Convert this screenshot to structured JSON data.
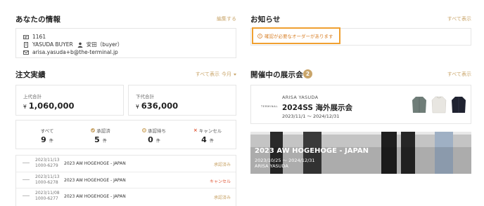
{
  "info": {
    "title": "あなたの情報",
    "edit_link": "編集する",
    "id": "1161",
    "company": "YASUDA BUYER",
    "user": "安田（buyer）",
    "email": "arisa.yasuda+b@the-terminal.jp"
  },
  "notices": {
    "title": "お知らせ",
    "see_all": "すべて表示",
    "alert": "確認が必要なオーダーがあります"
  },
  "orders": {
    "title": "注文実績",
    "see_all": "すべて表示",
    "period": "今月",
    "upper_label": "上代合計",
    "upper_value": "1,060,000",
    "lower_label": "下代合計",
    "lower_value": "636,000",
    "currency": "¥",
    "stats": [
      {
        "label": "すべて",
        "count": "9",
        "unit": "件"
      },
      {
        "label": "承認済",
        "count": "5",
        "unit": "件"
      },
      {
        "label": "承認待ち",
        "count": "0",
        "unit": "件"
      },
      {
        "label": "キャンセル",
        "count": "4",
        "unit": "件"
      }
    ],
    "rows": [
      {
        "date": "2023/11/13",
        "no": "1000-6279",
        "name": "2023 AW HOGEHOGE - JAPAN",
        "status": "承認済み",
        "status_color": "#c9a56a"
      },
      {
        "date": "2023/11/13",
        "no": "1000-6278",
        "name": "2023 AW HOGEHOGE - JAPAN",
        "status": "キャンセル",
        "status_color": "#e05a3a"
      },
      {
        "date": "2023/11/08",
        "no": "1000-6277",
        "name": "2023 AW HOGEHOGE - JAPAN",
        "status": "承認済み",
        "status_color": "#c9a56a"
      }
    ]
  },
  "exhibitions": {
    "title": "開催中の展示会",
    "count": "2",
    "see_all": "すべて表示",
    "items": [
      {
        "logo": "TERMINAL",
        "brand": "ARISA YASUDA",
        "title": "2024SS 海外展示会",
        "period": "2023/11/1 〜 2024/12/31"
      },
      {
        "title": "2023 AW HOGEHOGE - JAPAN",
        "period": "2023/10/25 〜 2024/12/31",
        "brand": "ARISA YASUDA"
      }
    ]
  },
  "colors": {
    "accent": "#c9a56a",
    "alert": "#f0a030",
    "cancel": "#e05a3a",
    "approved": "#c9a56a"
  }
}
